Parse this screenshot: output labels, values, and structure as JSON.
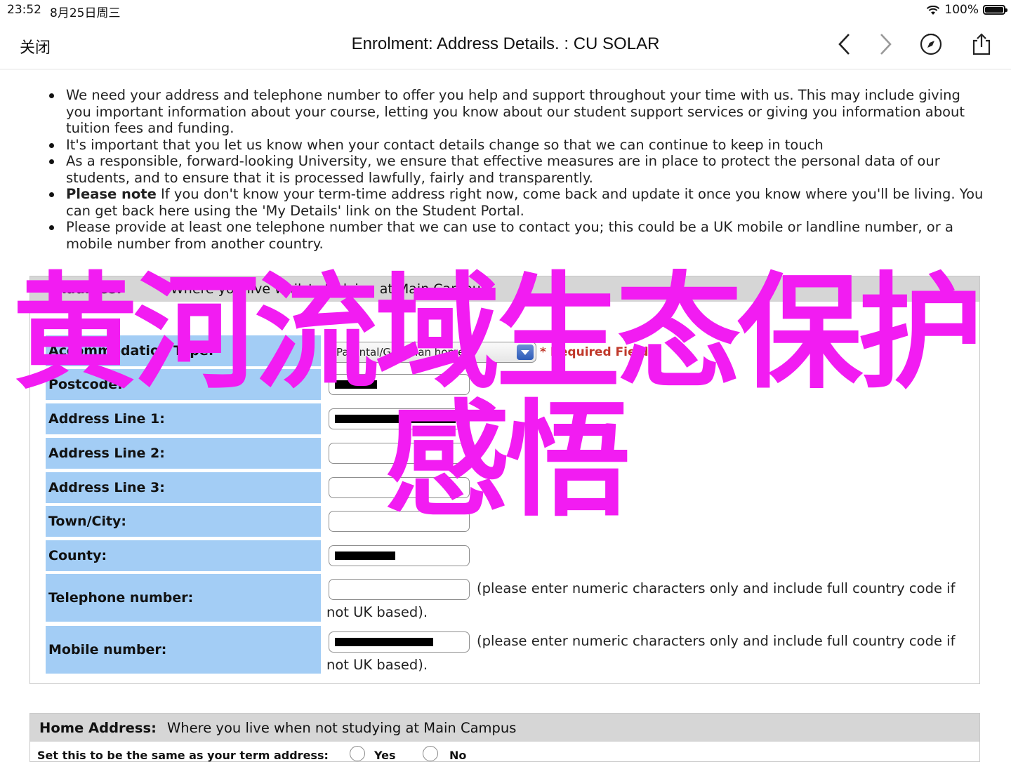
{
  "status_bar": {
    "time": "23:52",
    "date": "8月25日周三",
    "battery": "100%"
  },
  "nav": {
    "close": "关闭",
    "title": "Enrolment: Address Details. : CU SOLAR"
  },
  "intro": [
    {
      "bold": "",
      "text": "We need your address and telephone number to offer you help and support throughout your time with us. This may include giving you important information about your course, letting you know about our student support services or giving you information about tuition fees and funding."
    },
    {
      "bold": "",
      "text": "It's important that you let us know when your contact details change so that we can continue to keep in touch"
    },
    {
      "bold": "",
      "text": "As a responsible, forward-looking University, we ensure that effective measures are in place to protect the personal data of our students, and to ensure that it is processed lawfully, fairly and transparently."
    },
    {
      "bold": "Please note",
      "text": " If you don't know your term-time address right now, come back and update it once you know where you'll be living. You can get back here using the 'My Details' link on the Student Portal."
    },
    {
      "bold": "",
      "text": "Please provide at least one telephone number that we can use to contact you; this could be a UK mobile or landline number, or a mobile number from another country."
    }
  ],
  "term_panel": {
    "heading": "Address:",
    "subheading": "Where you live whilst studying at Main Campus",
    "accommodation_label": "Accommodation Type:",
    "accommodation_value": "Parental/Guardian home",
    "required_note": "* Required Field",
    "postcode_label": "Postcode:",
    "address1_label": "Address Line 1:",
    "address2_label": "Address Line 2:",
    "address3_label": "Address Line 3:",
    "town_label": "Town/City:",
    "county_label": "County:",
    "telephone_label": "Telephone number:",
    "mobile_label": "Mobile number:",
    "numeric_hint": "(please enter numeric characters only and include full country code if not UK based)."
  },
  "home_panel": {
    "heading": "Home Address:",
    "subheading": "Where you live when not studying at Main Campus",
    "question": "Set this to be the same as your term address:",
    "yes": "Yes",
    "no": "No"
  },
  "overlay": {
    "line1": "黄河流域生态保护",
    "line2": "感悟",
    "color": "#f21cf2"
  },
  "colors": {
    "label_bg": "#a3cdf5",
    "header_bg": "#d6d6d6",
    "required": "#c0392b"
  },
  "icons": [
    "back-chevron-icon",
    "forward-chevron-icon",
    "compass-icon",
    "share-icon",
    "wifi-icon",
    "battery-icon"
  ]
}
